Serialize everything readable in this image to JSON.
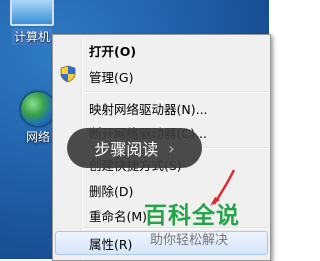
{
  "desktop": {
    "computer_label": "计算机",
    "network_label": "网络"
  },
  "menu": {
    "items": [
      {
        "label": "打开(O)",
        "bold": true
      },
      {
        "label": "管理(G)"
      },
      {
        "label": "映射网络驱动器(N)..."
      },
      {
        "label": "断开网络驱动器(C)..."
      },
      {
        "label": "创建快捷方式(S)"
      },
      {
        "label": "删除(D)"
      },
      {
        "label": "重命名(M)"
      },
      {
        "label": "属性(R)"
      }
    ]
  },
  "overlay": {
    "label": "步骤阅读",
    "chevron": "›"
  },
  "watermark": {
    "title": "百科全说",
    "subtitle": "助你轻松解决"
  },
  "colors": {
    "desktop": "#1f5fa8",
    "watermark_green": "#27a34a"
  }
}
